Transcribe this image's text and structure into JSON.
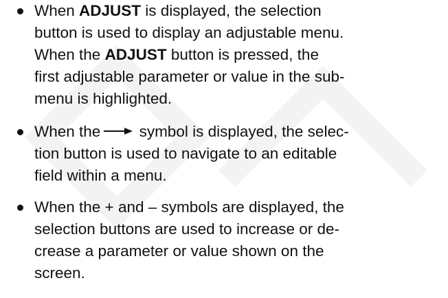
{
  "bullets": [
    {
      "lines": [
        {
          "prefix": "When ",
          "bold": "ADJUST",
          "suffix": " is displayed, the selection"
        },
        {
          "text": "button is used to display an adjustable menu."
        },
        {
          "prefix": "When the ",
          "bold": "ADJUST",
          "suffix": " button is pressed, the"
        },
        {
          "text": "first adjustable parameter or value in the sub-"
        },
        {
          "text": "menu is highlighted."
        }
      ]
    },
    {
      "lines": [
        {
          "prefix": "When the",
          "symbol": "right-arrow",
          "suffix": " symbol is displayed, the selec-"
        },
        {
          "text": "tion button is used to navigate to an editable"
        },
        {
          "text": "field within a menu."
        }
      ]
    },
    {
      "lines": [
        {
          "text": "When the + and – symbols are displayed, the"
        },
        {
          "text": "selection buttons are used to increase or de-"
        },
        {
          "text": "crease a parameter or value shown on the"
        },
        {
          "text": "screen."
        }
      ]
    }
  ],
  "colors": {
    "text": "#111111",
    "background": "#ffffff",
    "watermark": "#f3f3f3"
  }
}
